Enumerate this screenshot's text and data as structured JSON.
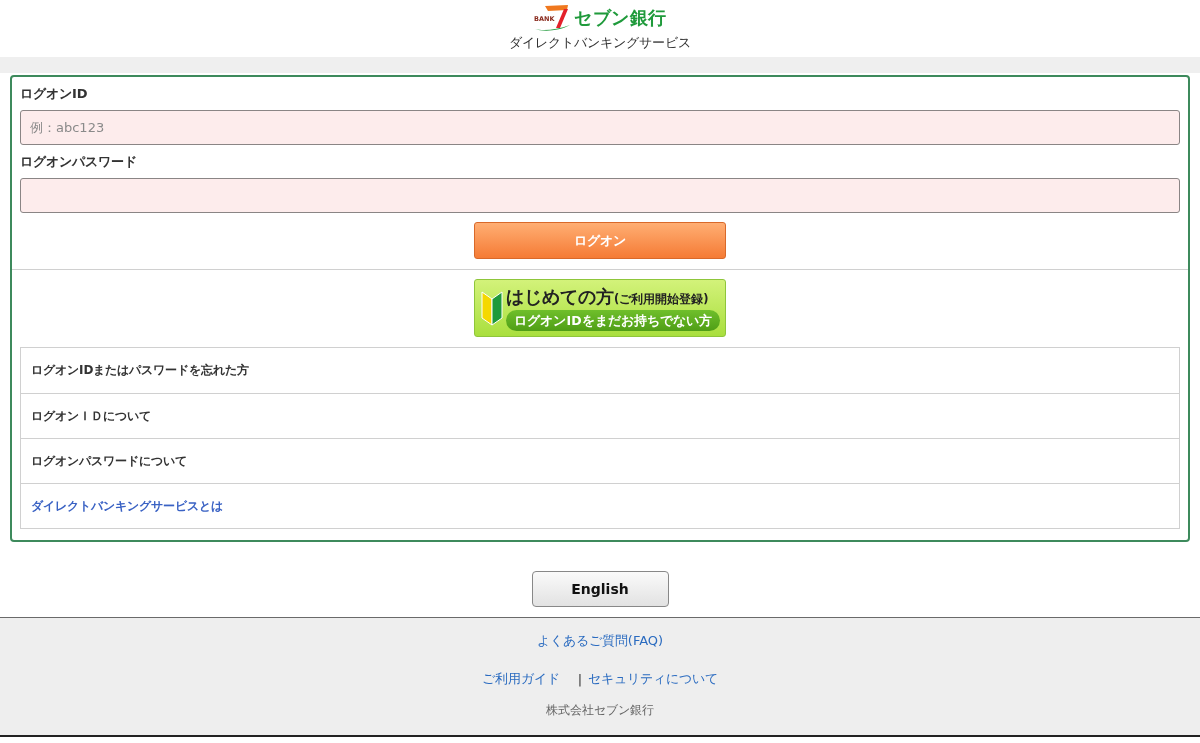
{
  "header": {
    "logo": {
      "mark_text": "BANK",
      "name": "セブン銀行"
    },
    "subtitle": "ダイレクトバンキングサービス"
  },
  "login_form": {
    "fields": [
      {
        "label": "ログオンID",
        "placeholder": "例：abc123"
      },
      {
        "label": "ログオンパスワード"
      }
    ],
    "submit_button": "ログオン"
  },
  "signup_banner": {
    "title": "はじめての方",
    "title_note": "(ご利用開始登録)",
    "subtitle": "ログオンIDをまだお持ちでない方"
  },
  "help_links": [
    {
      "kind": "text",
      "label": "ログオンIDまたはパスワードを忘れた方"
    },
    {
      "kind": "text",
      "label": "ログオンＩＤについて"
    },
    {
      "kind": "text",
      "label": "ログオンパスワードについて"
    },
    {
      "kind": "link",
      "label": "ダイレクトバンキングサービスとは"
    }
  ],
  "language_button": "English",
  "footer": {
    "link_rows": [
      [
        "よくあるご質問(FAQ)"
      ],
      [
        "ご利用ガイド",
        "セキュリティについて"
      ]
    ],
    "separator": "|",
    "copyright": "株式会社セブン銀行"
  }
}
